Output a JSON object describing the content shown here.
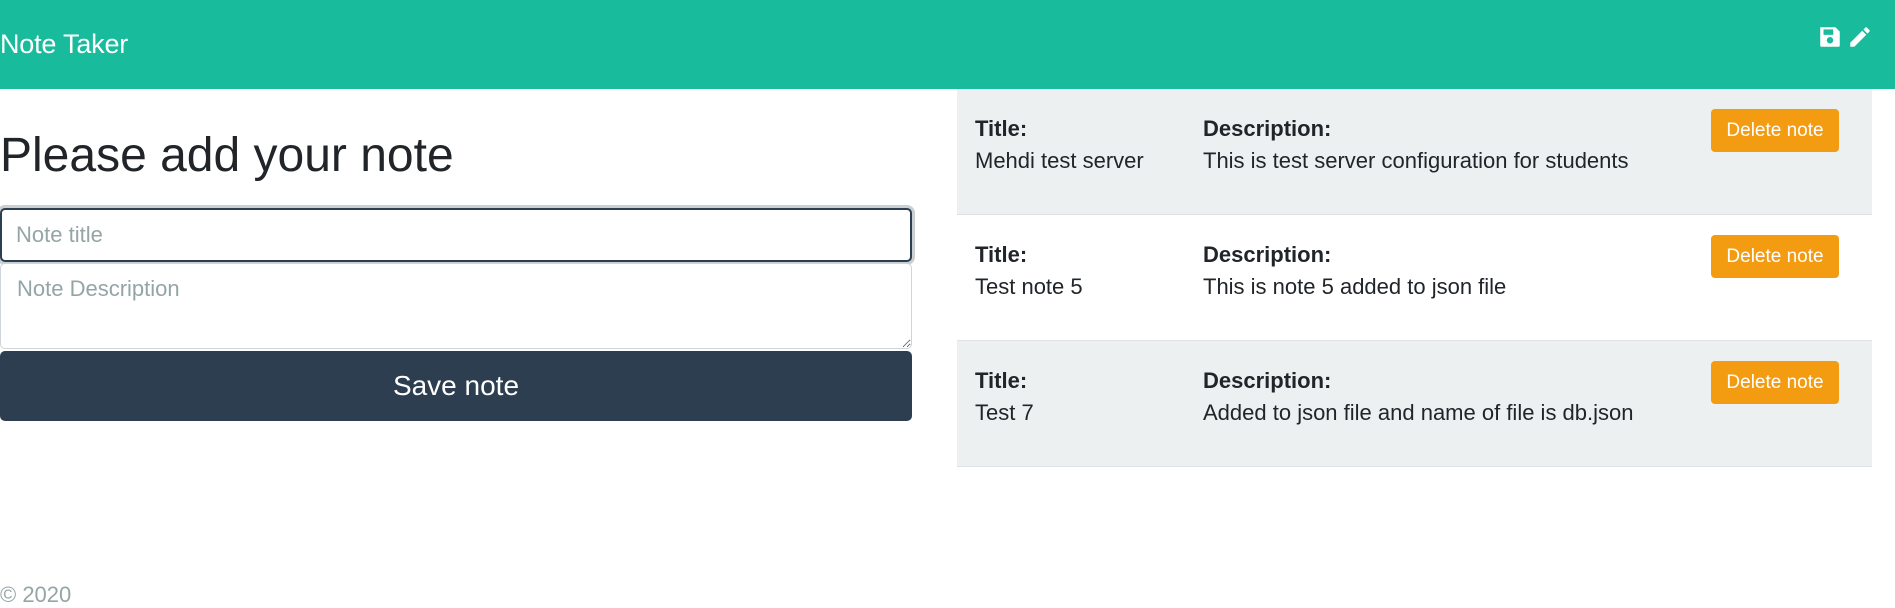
{
  "navbar": {
    "brand": "Note Taker",
    "icons": [
      "save-icon",
      "pencil-icon"
    ],
    "color": "#18bc9c"
  },
  "form": {
    "heading": "Please add your note",
    "title_placeholder": "Note title",
    "title_value": "",
    "description_placeholder": "Note Description",
    "description_value": "",
    "save_label": "Save note"
  },
  "notes": [
    {
      "title_label": "Title:",
      "title": "Mehdi test server",
      "description_label": "Description:",
      "description": "This is test server configuration for students",
      "delete_label": "Delete note"
    },
    {
      "title_label": "Title:",
      "title": "Test note 5",
      "description_label": "Description:",
      "description": "This is note 5 added to json file",
      "delete_label": "Delete note"
    },
    {
      "title_label": "Title:",
      "title": "Test 7",
      "description_label": "Description:",
      "description": "Added to json file and name of file is db.json",
      "delete_label": "Delete note"
    }
  ],
  "footer": {
    "text": "© 2020"
  },
  "colors": {
    "primary": "#2c3e50",
    "success": "#18bc9c",
    "warning": "#f39c12",
    "muted": "#95a5a6",
    "light": "#ecf0f1"
  }
}
